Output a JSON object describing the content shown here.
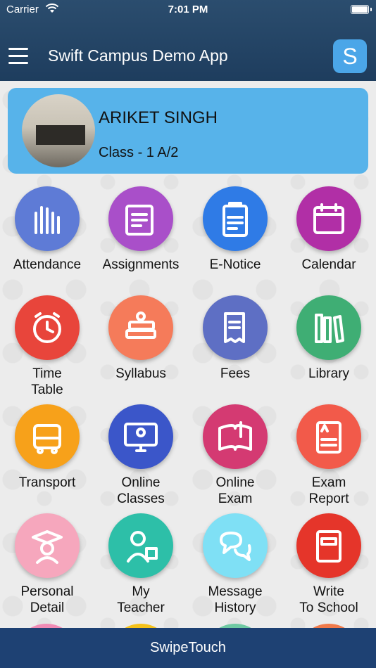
{
  "status_bar": {
    "carrier": "Carrier",
    "time": "7:01 PM"
  },
  "header": {
    "title": "Swift Campus Demo App",
    "logo_letter": "S"
  },
  "profile": {
    "name": "ARIKET SINGH",
    "class_label": "Class - 1 A/2"
  },
  "menu": [
    {
      "label": "Attendance",
      "icon": "raised-hands-icon",
      "color": "#5e7bd6"
    },
    {
      "label": "Assignments",
      "icon": "notebook-pencil-icon",
      "color": "#a94fc9"
    },
    {
      "label": "E-Notice",
      "icon": "clipboard-notice-icon",
      "color": "#2f7be6"
    },
    {
      "label": "Calendar",
      "icon": "calendar-icon",
      "color": "#b12fa6"
    },
    {
      "label": "Time\nTable",
      "icon": "alarm-clock-icon",
      "color": "#e8453b"
    },
    {
      "label": "Syllabus",
      "icon": "book-stack-icon",
      "color": "#f57b5a"
    },
    {
      "label": "Fees",
      "icon": "fee-receipt-icon",
      "color": "#5e6fc4"
    },
    {
      "label": "Library",
      "icon": "books-icon",
      "color": "#3fae74"
    },
    {
      "label": "Transport",
      "icon": "bus-icon",
      "color": "#f7a11a"
    },
    {
      "label": "Online\nClasses",
      "icon": "online-class-icon",
      "color": "#3b56c9"
    },
    {
      "label": "Online\nExam",
      "icon": "online-exam-icon",
      "color": "#d43a72"
    },
    {
      "label": "Exam\nReport",
      "icon": "exam-report-icon",
      "color": "#f25a4a"
    },
    {
      "label": "Personal\nDetail",
      "icon": "graduate-icon",
      "color": "#f6a7bd"
    },
    {
      "label": "My\nTeacher",
      "icon": "teacher-icon",
      "color": "#2dbfa8"
    },
    {
      "label": "Message\nHistory",
      "icon": "chat-bubbles-icon",
      "color": "#7fe0f5"
    },
    {
      "label": "Write\nTo School",
      "icon": "write-notebook-icon",
      "color": "#e5352a"
    }
  ],
  "bottom_bar": {
    "label": "SwipeTouch"
  }
}
